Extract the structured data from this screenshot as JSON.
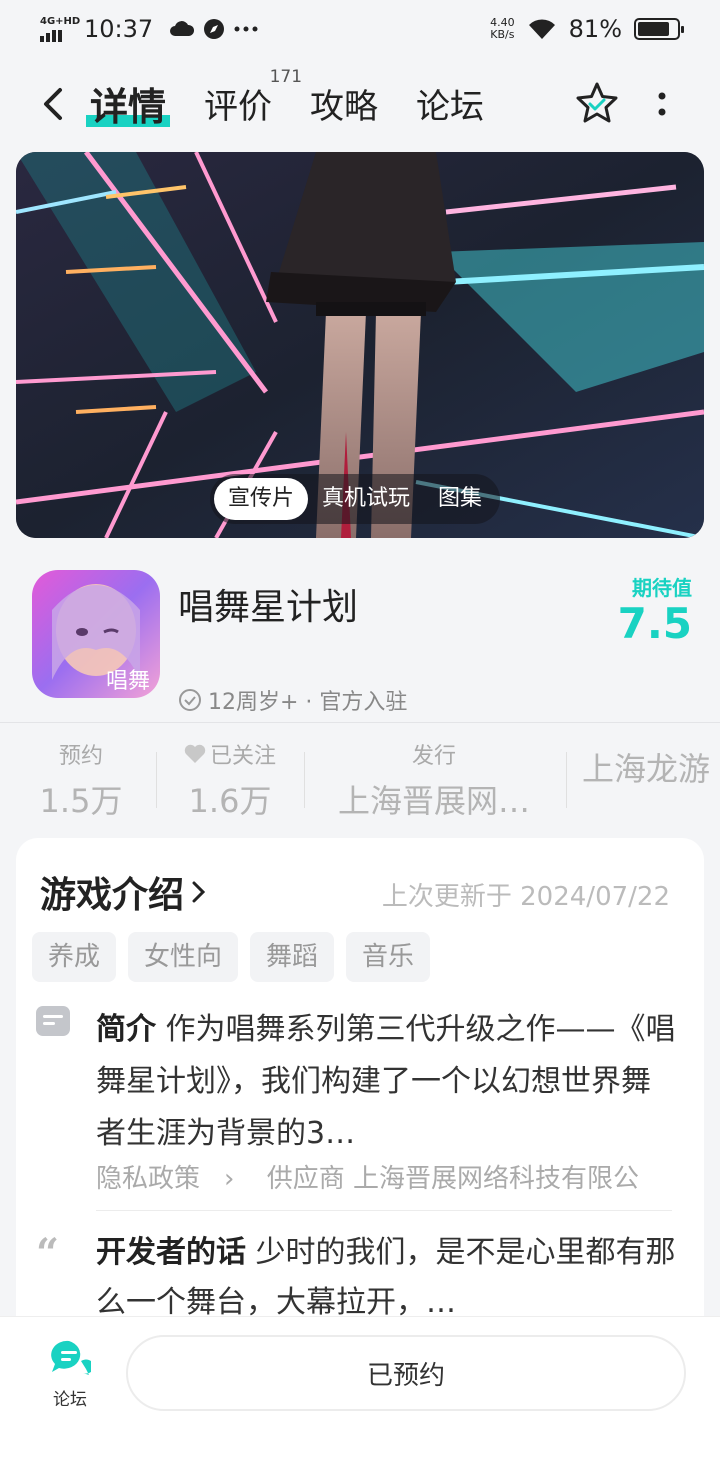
{
  "status_bar": {
    "network": "4G+HD",
    "time": "10:37",
    "speed_value": "4.40",
    "speed_unit": "KB/s",
    "battery": "81%",
    "battery_level": 0.81
  },
  "nav": {
    "tabs": [
      {
        "label": "详情",
        "active": true
      },
      {
        "label": "评价",
        "badge": "171"
      },
      {
        "label": "攻略"
      },
      {
        "label": "论坛"
      }
    ]
  },
  "media": {
    "switch": [
      "宣传片",
      "真机试玩",
      "图集"
    ],
    "active_index": 0
  },
  "app": {
    "name": "唱舞星计划",
    "meta": "12周岁+ · 官方入驻",
    "expect_label": "期待值",
    "expect_value": "7.5",
    "icon_text": "唱舞"
  },
  "stats": [
    {
      "label": "预约",
      "value": "1.5万"
    },
    {
      "label": "已关注",
      "value": "1.6万"
    },
    {
      "label": "发行",
      "value": "上海晋展网…"
    },
    {
      "label": "",
      "value": "上海龙游"
    }
  ],
  "intro": {
    "title": "游戏介绍",
    "updated": "上次更新于 2024/07/22",
    "tags": [
      "养成",
      "女性向",
      "舞蹈",
      "音乐"
    ],
    "summary_label": "简介",
    "summary": "作为唱舞系列第三代升级之作——《唱舞星计划》，我们构建了一个以幻想世界舞者生涯为背景的3…",
    "privacy": "隐私政策",
    "supplier": "供应商 上海晋展网络科技有限公",
    "dev_label": "开发者的话",
    "dev_text": "少时的我们，是不是心里都有那么一个舞台，大幕拉开，…"
  },
  "bottom": {
    "forum_label": "论坛",
    "reserve_label": "已预约"
  },
  "colors": {
    "accent": "#19d2c2"
  }
}
